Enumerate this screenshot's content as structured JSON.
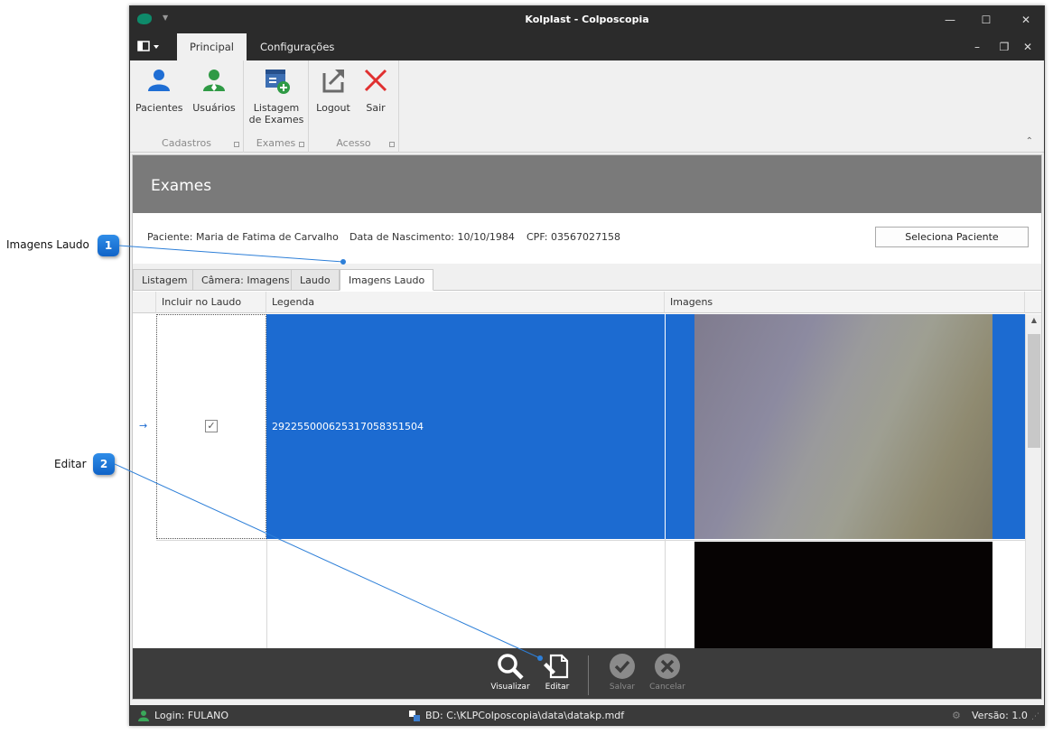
{
  "window": {
    "title": "Kolplast - Colposcopia"
  },
  "ribbon_tabs": [
    {
      "label": "Principal",
      "active": true
    },
    {
      "label": "Configurações",
      "active": false
    }
  ],
  "ribbon": {
    "groups": [
      {
        "label": "Cadastros",
        "buttons": [
          {
            "label": "Pacientes",
            "icon": "person-icon"
          },
          {
            "label": "Usuários",
            "icon": "user-icon"
          }
        ]
      },
      {
        "label": "Exames",
        "buttons": [
          {
            "label_line1": "Listagem",
            "label_line2": "de Exames",
            "icon": "exam-list-icon"
          }
        ]
      },
      {
        "label": "Acesso",
        "buttons": [
          {
            "label": "Logout",
            "icon": "logout-icon"
          },
          {
            "label": "Sair",
            "icon": "close-icon"
          }
        ]
      }
    ]
  },
  "page": {
    "title": "Exames"
  },
  "patient": {
    "name": "Paciente: Maria de Fatima de Carvalho",
    "birth": "Data de Nascimento: 10/10/1984",
    "cpf": "CPF: 03567027158",
    "select_button": "Seleciona Paciente"
  },
  "tabs": [
    "Listagem",
    "Câmera: Imagens",
    "Laudo",
    "Imagens Laudo"
  ],
  "grid": {
    "columns": [
      "Incluir no Laudo",
      "Legenda",
      "Imagens"
    ],
    "rows": [
      {
        "included": true,
        "caption": "2922550006253170583515​04",
        "selected": true
      },
      {
        "included": false,
        "caption": "",
        "selected": false
      }
    ],
    "row_indicator": "→"
  },
  "bottom_buttons": [
    {
      "label": "Visualizar",
      "icon": "magnifier-icon",
      "enabled": true
    },
    {
      "label": "Editar",
      "icon": "edit-icon",
      "enabled": true
    },
    {
      "label": "Salvar",
      "icon": "check-icon",
      "enabled": false
    },
    {
      "label": "Cancelar",
      "icon": "cancel-icon",
      "enabled": false
    }
  ],
  "status": {
    "login": "Login: FULANO",
    "db": "BD: C:\\KLPColposcopia\\data\\datakp.mdf",
    "version": "Versão: 1.0"
  },
  "callouts": [
    {
      "number": "1",
      "label": "Imagens Laudo"
    },
    {
      "number": "2",
      "label": "Editar"
    }
  ],
  "colors": {
    "accent": "#1c6bd1",
    "titlebar": "#2b2b2b",
    "header": "#7a7a7a"
  }
}
